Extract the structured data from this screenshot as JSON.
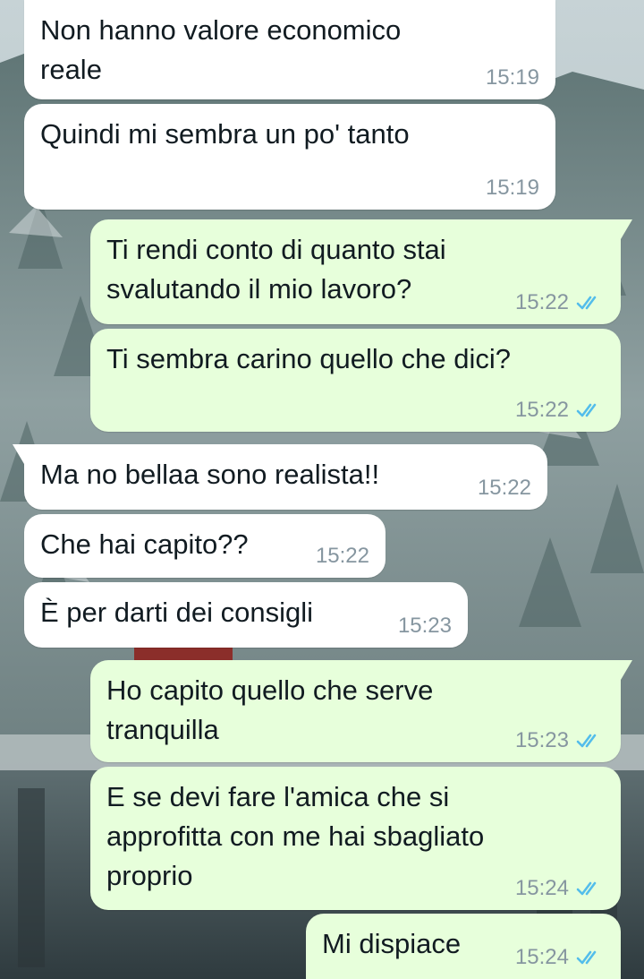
{
  "colors": {
    "incoming_bubble": "#ffffff",
    "outgoing_bubble": "#e7ffdb",
    "timestamp": "#8696a0",
    "read_ticks": "#53bdeb",
    "text": "#111b21"
  },
  "wallpaper": {
    "description_icon": "snowy-forest-lake-wallpaper"
  },
  "messages": [
    {
      "direction": "in",
      "text": "Non hanno valore economico\nreale",
      "time": "15:19"
    },
    {
      "direction": "in",
      "text": "Quindi mi sembra un po' tanto",
      "time": "15:19"
    },
    {
      "direction": "out",
      "text": "Ti rendi conto di quanto stai\nsvalutando il mio lavoro?",
      "time": "15:22",
      "status": "read"
    },
    {
      "direction": "out",
      "text": "Ti sembra carino quello che dici?",
      "time": "15:22",
      "status": "read"
    },
    {
      "direction": "in",
      "text": "Ma no bellaa sono realista!!",
      "time": "15:22"
    },
    {
      "direction": "in",
      "text": "Che hai capito??",
      "time": "15:22"
    },
    {
      "direction": "in",
      "text": "È per darti dei consigli",
      "time": "15:23"
    },
    {
      "direction": "out",
      "text": "Ho capito quello che serve\ntranquilla",
      "time": "15:23",
      "status": "read"
    },
    {
      "direction": "out",
      "text": "E se devi fare l'amica che si\napprofitta con me hai sbagliato\nproprio",
      "time": "15:24",
      "status": "read"
    },
    {
      "direction": "out",
      "text": "Mi dispiace",
      "time": "15:24",
      "status": "read"
    }
  ]
}
